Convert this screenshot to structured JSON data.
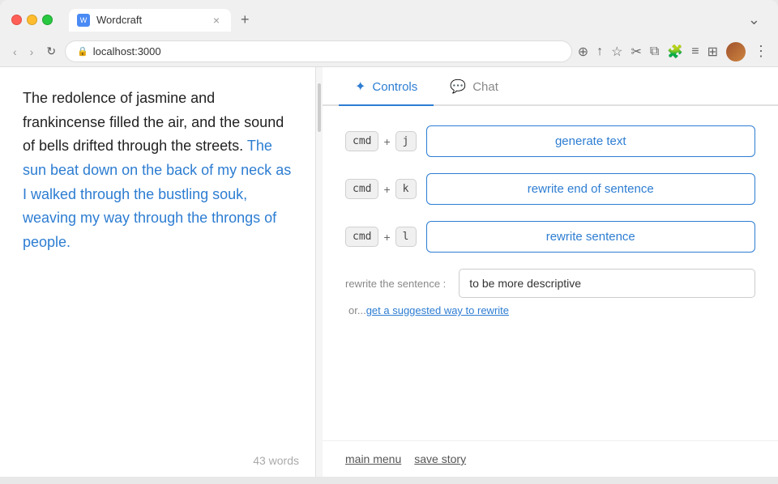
{
  "browser": {
    "tab_title": "Wordcraft",
    "tab_icon": "W",
    "address": "localhost:3000",
    "close_label": "×",
    "new_tab_label": "+",
    "more_label": "⋮",
    "expand_label": "⌄"
  },
  "editor": {
    "text_normal_1": "The redolence of jasmine and frankincense filled the air, and the sound of bells drifted through the streets.",
    "text_highlighted": "The sun beat down on the back of my neck as I walked through the bustling souk, weaving my way through the throngs of people.",
    "word_count": "43 words"
  },
  "controls": {
    "panel_tab_controls": "Controls",
    "panel_tab_chat": "Chat",
    "cmd_label": "cmd",
    "plus_label": "+",
    "key_j": "j",
    "key_k": "k",
    "key_l": "l",
    "btn_generate": "generate text",
    "btn_rewrite_end": "rewrite end of sentence",
    "btn_rewrite_sentence": "rewrite sentence",
    "rewrite_label": "rewrite the sentence :",
    "rewrite_placeholder": "to be more descriptive",
    "or_text": "or...",
    "suggest_link": "get a suggested way to rewrite"
  },
  "footer": {
    "main_menu": "main menu",
    "save_story": "save story"
  },
  "colors": {
    "accent": "#2d7dd2",
    "highlight_text": "#2d7dd2"
  }
}
